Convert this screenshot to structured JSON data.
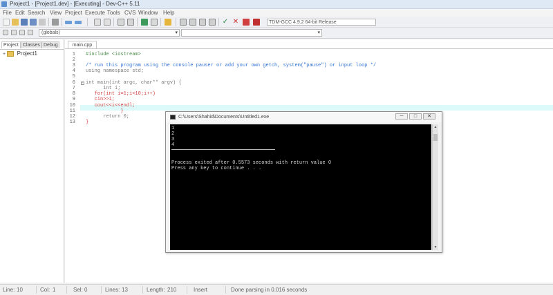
{
  "window": {
    "title": "Project1 - [Project1.dev] - [Executing] - Dev-C++ 5.11"
  },
  "menu": [
    "File",
    "Edit",
    "Search",
    "View",
    "Project",
    "Execute",
    "Tools",
    "CVS",
    "Window",
    "Help"
  ],
  "toolbar": {
    "compiler": "TDM-GCC 4.9.2 64-bit Release"
  },
  "toolbar2": {
    "class_combo": "(globals)",
    "member_combo": ""
  },
  "left_panel": {
    "tabs": [
      "Project",
      "Classes",
      "Debug"
    ],
    "tree_root": "Project1"
  },
  "editor": {
    "tab": "main.cpp",
    "line_numbers": [
      "1",
      "2",
      "3",
      "4",
      "5",
      "6",
      "7",
      "8",
      "9",
      "10",
      "11",
      "12",
      "13"
    ],
    "lines": [
      "#include <iostream>",
      "",
      "/* run this program using the console pauser or add your own getch, system(\"pause\") or input loop */",
      "using namespace std;",
      "",
      "int main(int argc, char** argv) {",
      "      int i;",
      "   for(int i=1;i<10;i++)",
      "   cin>>i;",
      "   cout<<i<<endl;",
      "            }",
      "      return 0;",
      "}"
    ]
  },
  "console": {
    "title": "C:\\Users\\Shahid\\Documents\\Untitled1.exe",
    "buttons": {
      "minimize": "─",
      "maximize": "□",
      "close": "✕"
    },
    "output": [
      "1",
      "2",
      "3",
      "4"
    ],
    "footer_line1": "Process exited after 0.5573 seconds with return value 0",
    "footer_line2": "Press any key to continue . . ."
  },
  "status": {
    "line_label": "Line:",
    "line": "10",
    "col_label": "Col:",
    "col": "1",
    "sel_label": "Sel:",
    "sel": "0",
    "lines_label": "Lines:",
    "lines": "13",
    "length_label": "Length:",
    "length": "210",
    "insert": "Insert",
    "message": "Done parsing in 0.016 seconds"
  },
  "colors": {
    "accent": "#5a8fd0",
    "highlight_line": "#dcfafa",
    "console_bg": "#000000",
    "comment": "#2f6fd0"
  }
}
